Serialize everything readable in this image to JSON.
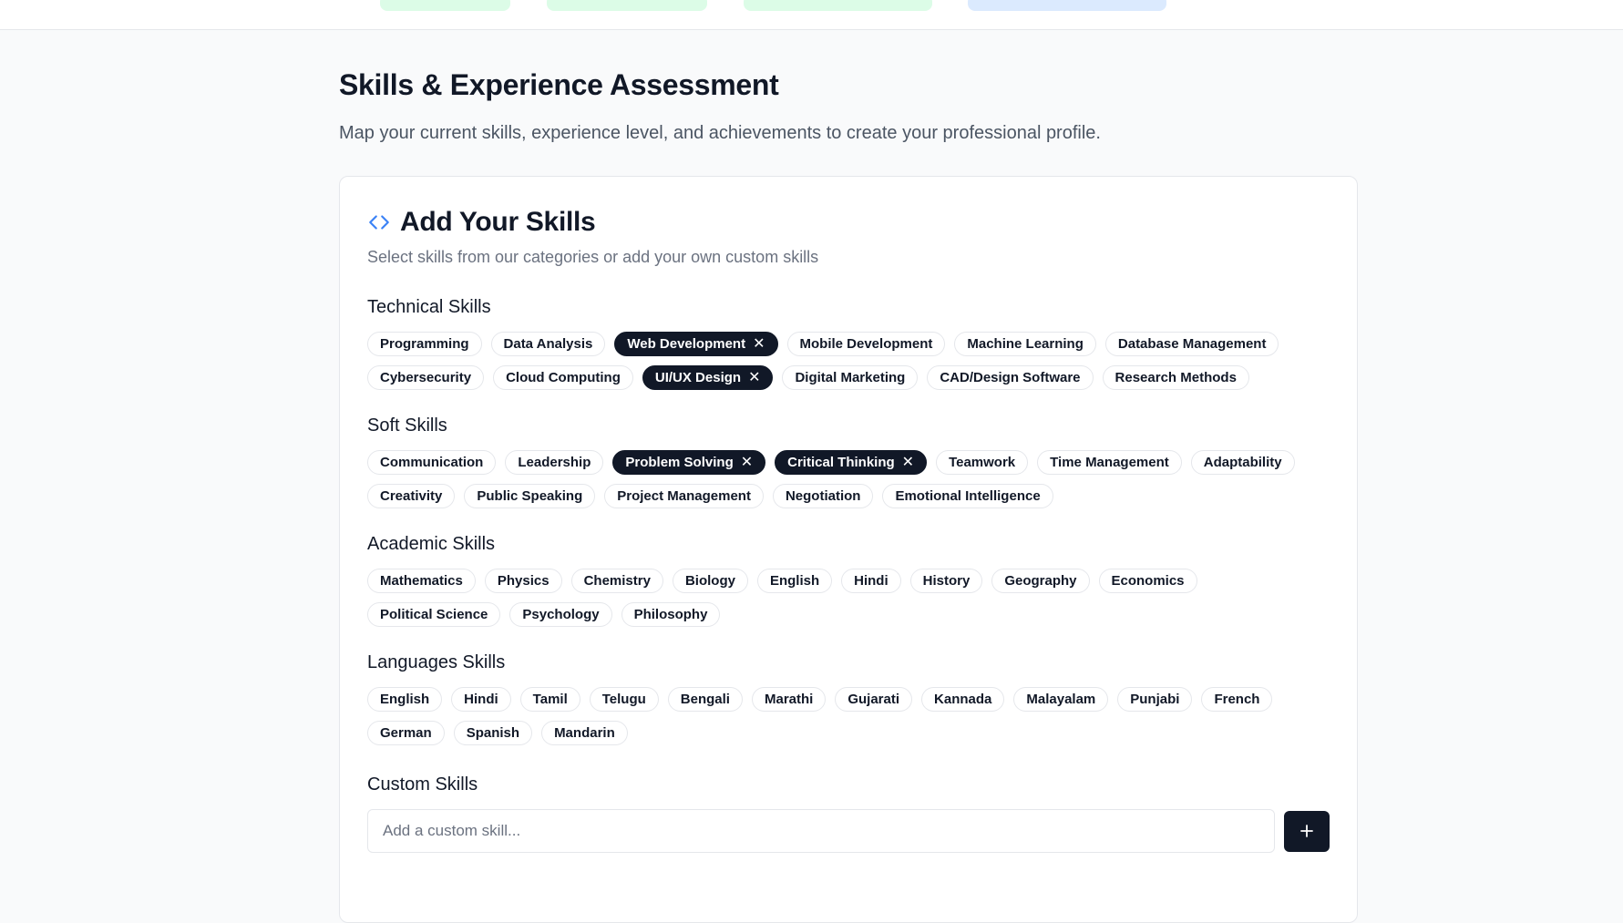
{
  "colors": {
    "selected_chip": "#111827",
    "accent_blue": "#3b82f6",
    "step_pill_green": "#dcfce7",
    "step_pill_blue": "#dbeafe"
  },
  "header": {
    "title": "Skills & Experience Assessment",
    "subtitle": "Map your current skills, experience level, and achievements to create your professional profile."
  },
  "card": {
    "icon": "code-icon",
    "title": "Add Your Skills",
    "description": "Select skills from our categories or add your own custom skills"
  },
  "categories": [
    {
      "title": "Technical Skills",
      "skills": [
        {
          "label": "Programming",
          "selected": false
        },
        {
          "label": "Data Analysis",
          "selected": false
        },
        {
          "label": "Web Development",
          "selected": true
        },
        {
          "label": "Mobile Development",
          "selected": false
        },
        {
          "label": "Machine Learning",
          "selected": false
        },
        {
          "label": "Database Management",
          "selected": false
        },
        {
          "label": "Cybersecurity",
          "selected": false
        },
        {
          "label": "Cloud Computing",
          "selected": false
        },
        {
          "label": "UI/UX Design",
          "selected": true
        },
        {
          "label": "Digital Marketing",
          "selected": false
        },
        {
          "label": "CAD/Design Software",
          "selected": false
        },
        {
          "label": "Research Methods",
          "selected": false
        }
      ]
    },
    {
      "title": "Soft Skills",
      "skills": [
        {
          "label": "Communication",
          "selected": false
        },
        {
          "label": "Leadership",
          "selected": false
        },
        {
          "label": "Problem Solving",
          "selected": true
        },
        {
          "label": "Critical Thinking",
          "selected": true
        },
        {
          "label": "Teamwork",
          "selected": false
        },
        {
          "label": "Time Management",
          "selected": false
        },
        {
          "label": "Adaptability",
          "selected": false
        },
        {
          "label": "Creativity",
          "selected": false
        },
        {
          "label": "Public Speaking",
          "selected": false
        },
        {
          "label": "Project Management",
          "selected": false
        },
        {
          "label": "Negotiation",
          "selected": false
        },
        {
          "label": "Emotional Intelligence",
          "selected": false
        }
      ]
    },
    {
      "title": "Academic Skills",
      "skills": [
        {
          "label": "Mathematics",
          "selected": false
        },
        {
          "label": "Physics",
          "selected": false
        },
        {
          "label": "Chemistry",
          "selected": false
        },
        {
          "label": "Biology",
          "selected": false
        },
        {
          "label": "English",
          "selected": false
        },
        {
          "label": "Hindi",
          "selected": false
        },
        {
          "label": "History",
          "selected": false
        },
        {
          "label": "Geography",
          "selected": false
        },
        {
          "label": "Economics",
          "selected": false
        },
        {
          "label": "Political Science",
          "selected": false
        },
        {
          "label": "Psychology",
          "selected": false
        },
        {
          "label": "Philosophy",
          "selected": false
        }
      ]
    },
    {
      "title": "Languages Skills",
      "skills": [
        {
          "label": "English",
          "selected": false
        },
        {
          "label": "Hindi",
          "selected": false
        },
        {
          "label": "Tamil",
          "selected": false
        },
        {
          "label": "Telugu",
          "selected": false
        },
        {
          "label": "Bengali",
          "selected": false
        },
        {
          "label": "Marathi",
          "selected": false
        },
        {
          "label": "Gujarati",
          "selected": false
        },
        {
          "label": "Kannada",
          "selected": false
        },
        {
          "label": "Malayalam",
          "selected": false
        },
        {
          "label": "Punjabi",
          "selected": false
        },
        {
          "label": "French",
          "selected": false
        },
        {
          "label": "German",
          "selected": false
        },
        {
          "label": "Spanish",
          "selected": false
        },
        {
          "label": "Mandarin",
          "selected": false
        }
      ]
    }
  ],
  "custom": {
    "title": "Custom Skills",
    "placeholder": "Add a custom skill...",
    "value": "",
    "add_icon": "plus-icon"
  },
  "remove_icon": "close-icon"
}
